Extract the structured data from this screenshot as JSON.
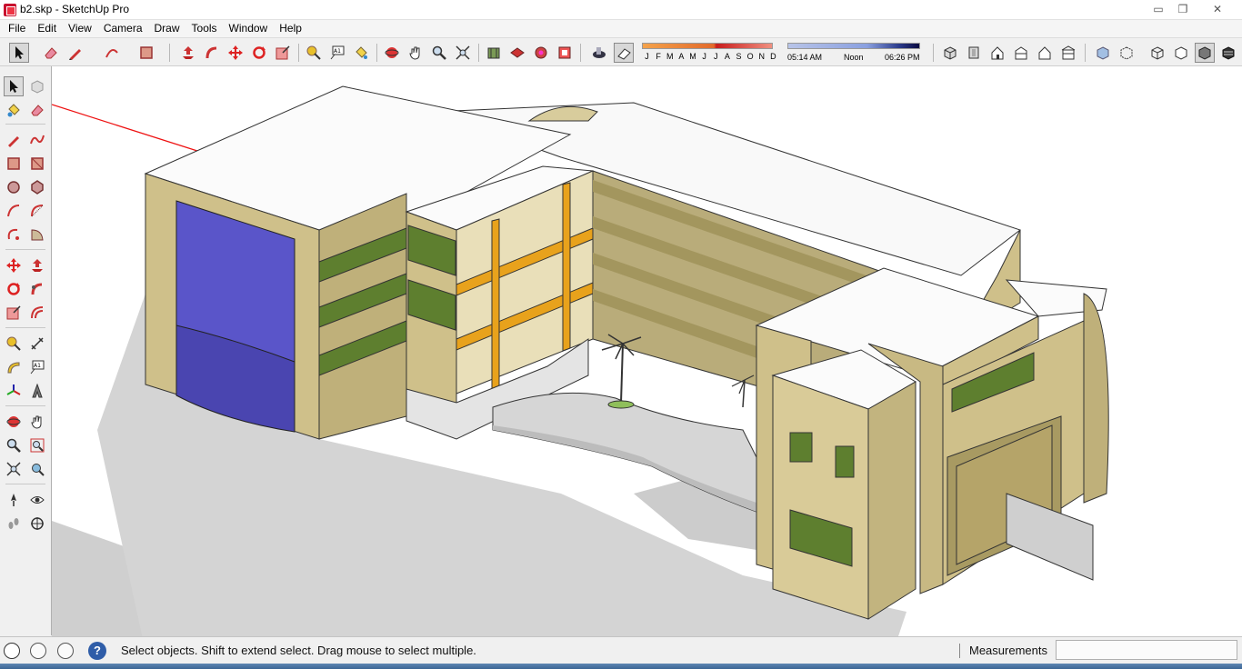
{
  "window": {
    "title": "b2.skp - SketchUp Pro",
    "minimize_glyph": "▭",
    "restore_glyph": "❐",
    "close_glyph": "✕"
  },
  "menu": {
    "items": [
      "File",
      "Edit",
      "View",
      "Camera",
      "Draw",
      "Tools",
      "Window",
      "Help"
    ]
  },
  "toolbar": {
    "tools": [
      "select",
      "eraser",
      "pencil-line",
      "arc",
      "rectangle",
      "push-pull",
      "follow-me",
      "move",
      "rotate",
      "scale",
      "tape-measure",
      "text",
      "paint-bucket",
      "orbit",
      "pan",
      "zoom",
      "zoom-extents",
      "3d-warehouse",
      "get-models",
      "share-model",
      "send-to-layout",
      "shadows-toggle",
      "fog-toggle"
    ],
    "view_tools": [
      "iso",
      "top",
      "front",
      "right",
      "back",
      "left"
    ],
    "style_tools": [
      "xray",
      "back-edges",
      "wireframe",
      "hidden-line",
      "shaded",
      "shaded-with-textures"
    ]
  },
  "shadow_settings": {
    "months": [
      "J",
      "F",
      "M",
      "A",
      "M",
      "J",
      "J",
      "A",
      "S",
      "O",
      "N",
      "D"
    ],
    "time_start": "05:14 AM",
    "time_mid": "Noon",
    "time_end": "06:26 PM"
  },
  "left_toolbar": {
    "tools": [
      "select",
      "make-component",
      "paint-bucket",
      "eraser",
      "line",
      "freehand",
      "rectangle",
      "rotated-rectangle",
      "circle",
      "polygon",
      "arc",
      "two-point-arc",
      "three-point-arc",
      "pie",
      "move",
      "push-pull",
      "rotate",
      "follow-me",
      "scale",
      "offset",
      "tape-measure",
      "dimension",
      "protractor",
      "text",
      "axes",
      "3d-text",
      "orbit",
      "pan",
      "zoom",
      "zoom-window",
      "zoom-extents",
      "previous",
      "position-camera",
      "look-around",
      "walk",
      "section-plane"
    ]
  },
  "status": {
    "help_glyph": "?",
    "message": "Select objects. Shift to extend select. Drag mouse to select multiple.",
    "measurements_label": "Measurements",
    "measurements_value": ""
  },
  "colors": {
    "accent_red": "#c8102e",
    "facade_tan": "#cfc08a",
    "glass_blue": "#5a55c9",
    "panel_green": "#5e7f2f",
    "beam_orange": "#e8a21c",
    "axis_red": "#e11"
  }
}
